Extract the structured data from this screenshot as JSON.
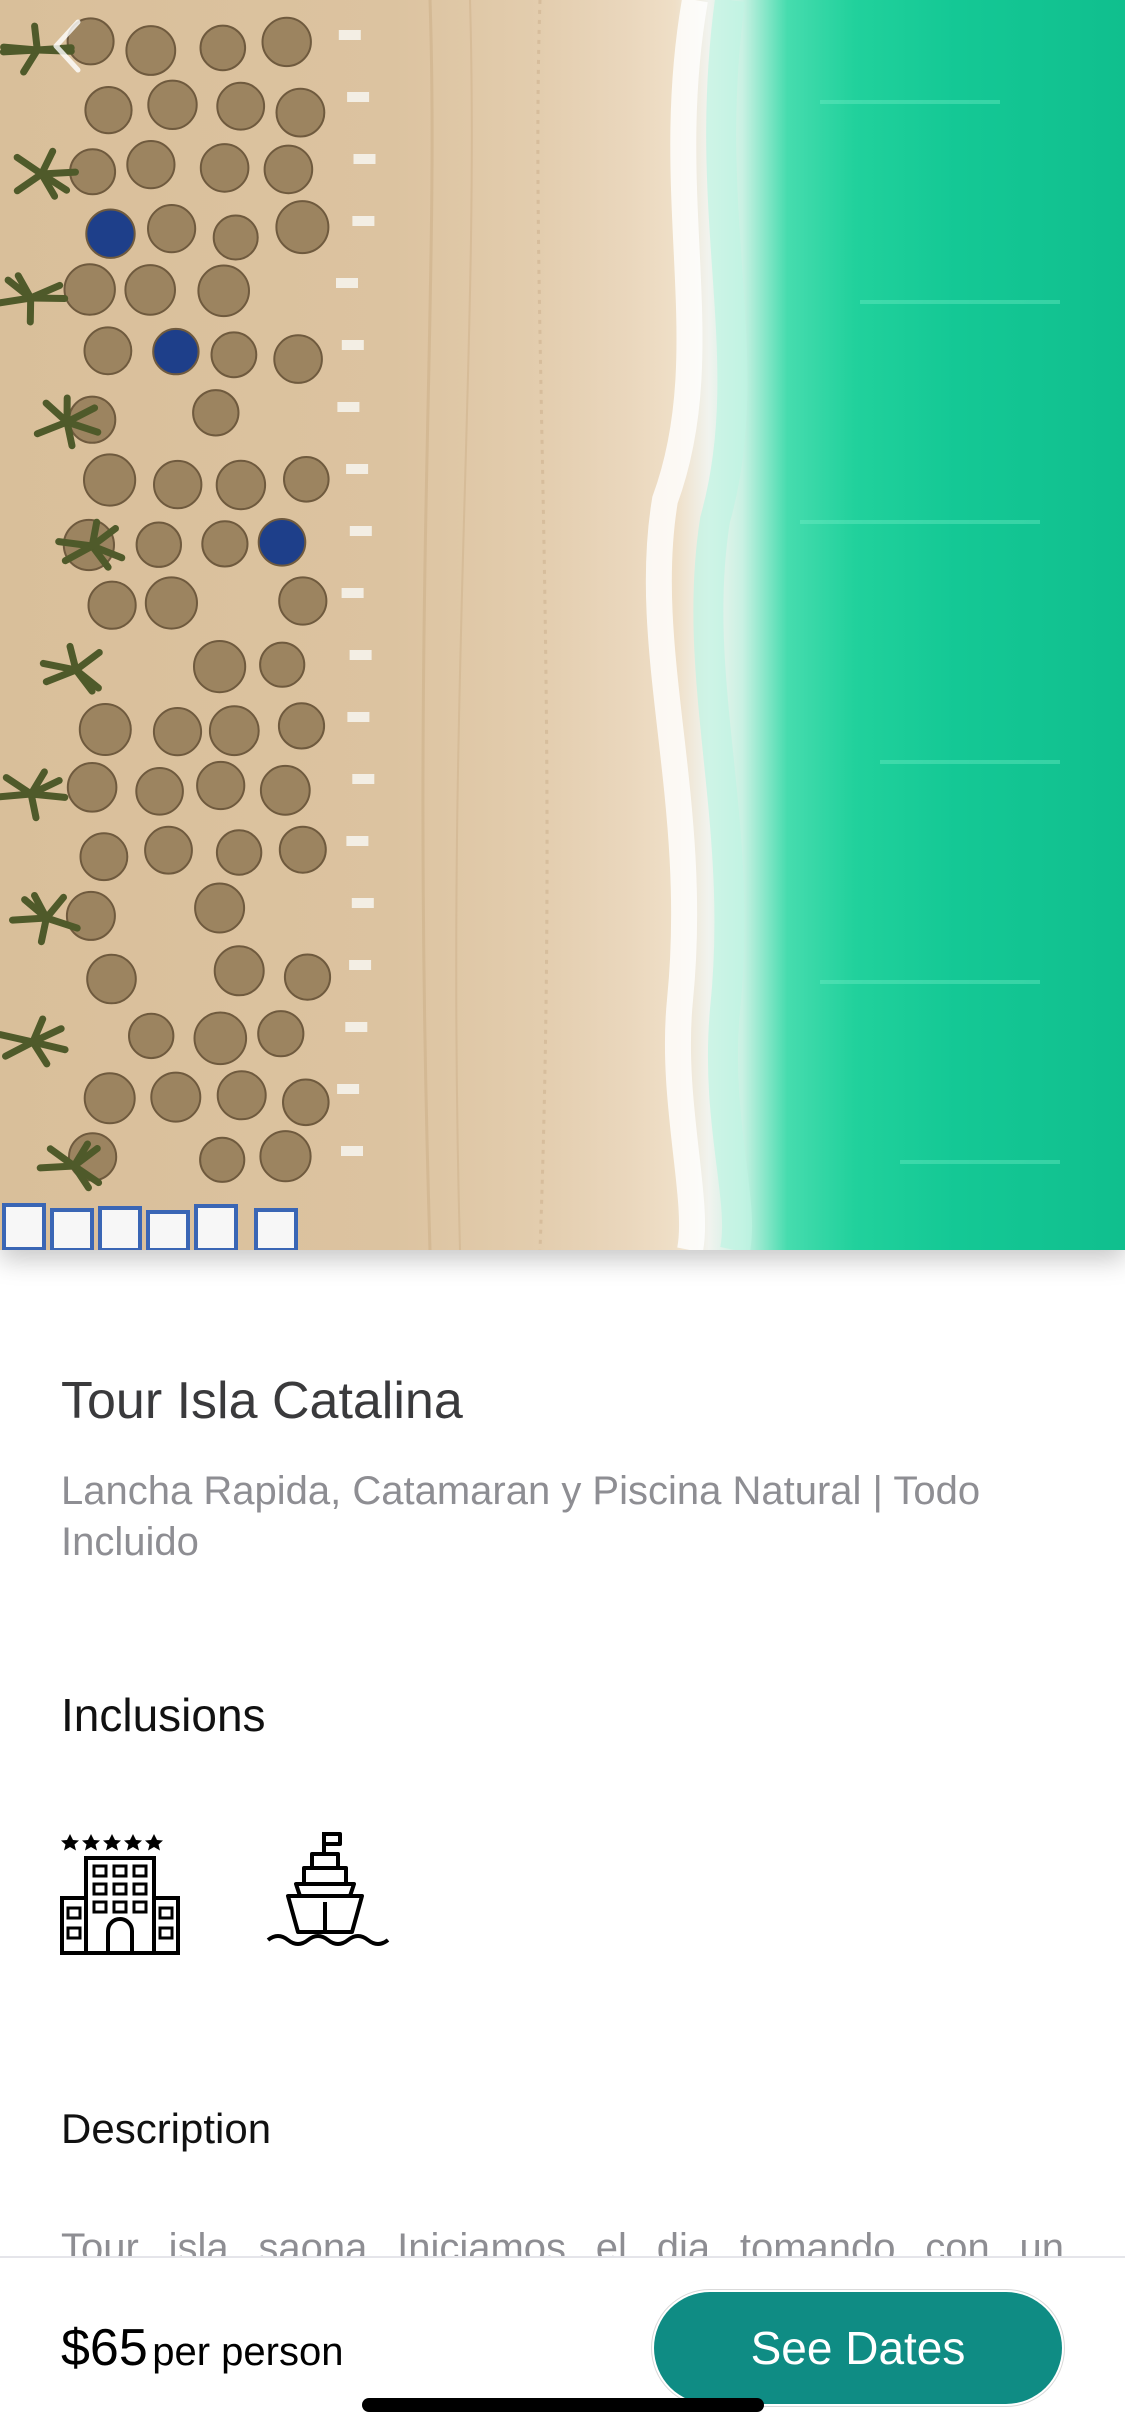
{
  "tour": {
    "title": "Tour Isla Catalina",
    "subtitle": "Lancha Rapida, Catamaran y Piscina Natural | Todo Incluido"
  },
  "sections": {
    "inclusions": "Inclusions",
    "description": "Description"
  },
  "inclusions": [
    {
      "icon": "hotel-icon"
    },
    {
      "icon": "boat-icon"
    }
  ],
  "description_text": "Tour isla saona Iniciamos el dia tomando con un",
  "booking": {
    "price": "$65",
    "price_unit": "per person",
    "cta_label": "See Dates"
  },
  "colors": {
    "accent": "#0f8c84",
    "title_text": "#3a3a3c",
    "muted_text": "#8e8e93"
  }
}
